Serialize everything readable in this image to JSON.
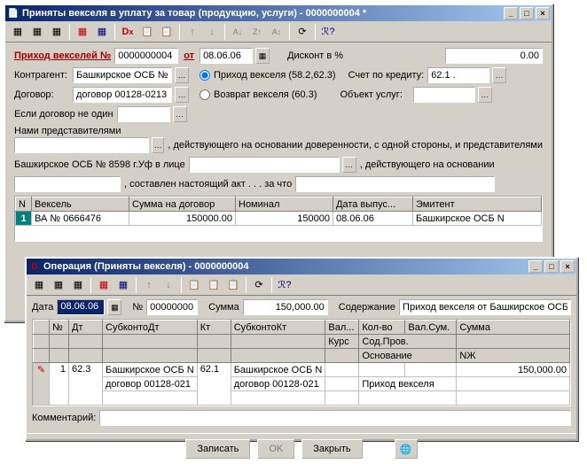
{
  "main": {
    "title": "Приняты векселя в уплату за товар (продукцию, услуги) - 0000000004 *",
    "header": {
      "label_prihod": "Приход векселей №",
      "doc_no": "0000000004",
      "label_ot": "от",
      "date": "08.06.06",
      "label_discount": "Дисконт в %",
      "discount": "0.00"
    },
    "form": {
      "label_kontragent": "Контрагент:",
      "kontragent": "Башкирское ОСБ №",
      "radio_prihod": "Приход векселя (58.2,62.3)",
      "label_schet": "Счет по кредиту:",
      "schet": "62.1 .",
      "label_dogovor": "Договор:",
      "dogovor": "договор 00128-0213",
      "radio_vozvrat": "Возврат векселя (60.3)",
      "label_object": "Объект услуг:",
      "object": "",
      "label_eslidog": "Если договор не один",
      "eslidog": "",
      "label_nami": "Нами представителями",
      "nami": "",
      "text_deist1": ", действующего на основании доверенности, с одной стороны, и представителями",
      "bashkir_line": "Башкирское ОСБ № 8598 г.Уф в лице",
      "vlice": "",
      "text_deist2": ", действующего на основании",
      "osnov": "",
      "text_act": ", составлен настоящий акт . . . за что",
      "zachto": ""
    },
    "table": {
      "cols": [
        "N",
        "Вексель",
        "Сумма на договор",
        "Номинал",
        "Дата выпус...",
        "Эмитент"
      ],
      "row": {
        "n": "1",
        "veksel": "ВА № 0666476",
        "summa": "150000.00",
        "nominal": "150000",
        "date": "08.06.06",
        "emitent": "Башкирское ОСБ N"
      }
    }
  },
  "op": {
    "title": "Операция (Приняты векселя) - 0000000004",
    "header": {
      "label_date": "Дата",
      "date": "08.06.06",
      "label_no": "№",
      "no": "00000000",
      "label_summa": "Сумма",
      "summa": "150,000.00",
      "label_sod": "Содержание",
      "sod": "Приход векселя от Башкирское ОСБ"
    },
    "table": {
      "cols1": [
        "",
        "№",
        "Дт",
        "СубконтоДт",
        "Кт",
        "СубконтоКт",
        "Вал...",
        "Кол-во",
        "Вал.Сум.",
        "Сумма"
      ],
      "cols2": [
        "",
        "",
        "",
        "",
        "",
        "",
        "Курс",
        "Сод.Пров.",
        "",
        ""
      ],
      "cols3": [
        "",
        "",
        "",
        "",
        "",
        "",
        "",
        "Основание",
        "",
        "NЖ"
      ],
      "row1": {
        "mark": "",
        "n": "1",
        "dt": "62.3",
        "sdt": "Башкирское ОСБ N",
        "kt": "62.1",
        "skt": "Башкирское ОСБ N",
        "val": "",
        "kolvo": "",
        "valsum": "",
        "summa": "150,000.00"
      },
      "row2": {
        "sdt": "договор 00128-021",
        "skt": "договор 00128-021",
        "osn": "Приход векселя"
      }
    },
    "label_comment": "Комментарий:",
    "comment": "",
    "buttons": {
      "zapisat": "Записать",
      "ok": "OK",
      "zakryt": "Закрыть"
    }
  }
}
